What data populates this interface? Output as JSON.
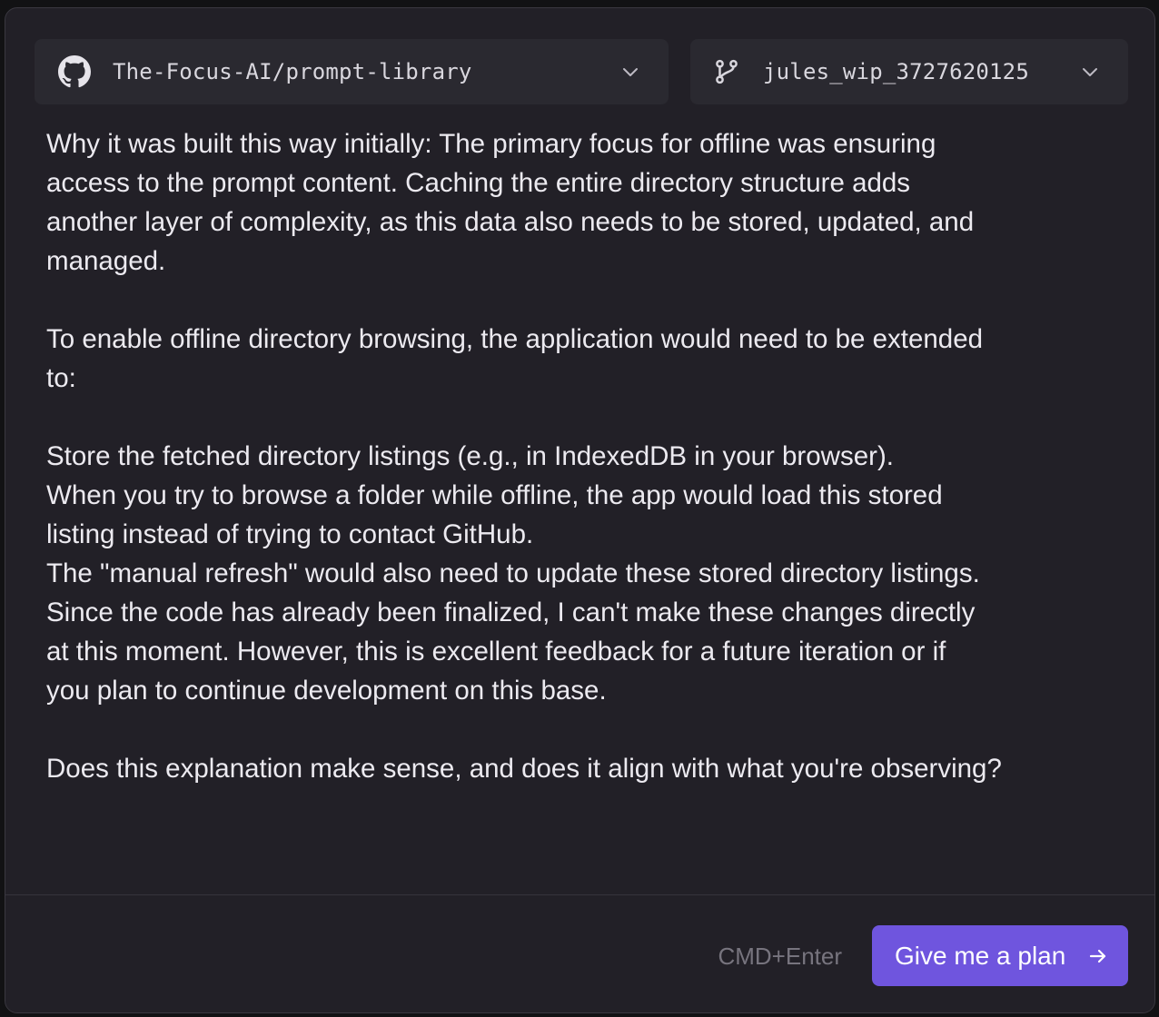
{
  "header": {
    "repo": {
      "label": "The-Focus-AI/prompt-library",
      "icon": "github-icon"
    },
    "branch": {
      "label": "jules_wip_3727620125",
      "icon": "git-branch-icon"
    }
  },
  "message": {
    "paragraph1": [
      "Why it was built this way initially: The primary focus for offline was ensuring",
      "access to the prompt content. Caching the entire directory structure adds",
      "another layer of complexity, as this data also needs to be stored, updated, and",
      "managed."
    ],
    "paragraph2": [
      "To enable offline directory browsing, the application would need to be extended",
      "to:"
    ],
    "paragraph3": [
      "Store the fetched directory listings (e.g., in IndexedDB in your browser).",
      "When you try to browse a folder while offline, the app would load this stored",
      "listing instead of trying to contact GitHub.",
      "The \"manual refresh\" would also need to update these stored directory listings.",
      "Since the code has already been finalized, I can't make these changes directly",
      "at this moment. However, this is excellent feedback for a future iteration or if",
      "you plan to continue development on this base."
    ],
    "paragraph4": [
      "Does this explanation make sense, and does it align with what you're observing?"
    ]
  },
  "footer": {
    "shortcut_hint": "CMD+Enter",
    "plan_button_label": "Give me a plan",
    "plan_button_icon": "arrow-right-icon"
  },
  "colors": {
    "background": "#222027",
    "selector_bg": "#2a2930",
    "text": "#eceaf0",
    "accent": "#6f55de",
    "muted": "#77747e"
  }
}
